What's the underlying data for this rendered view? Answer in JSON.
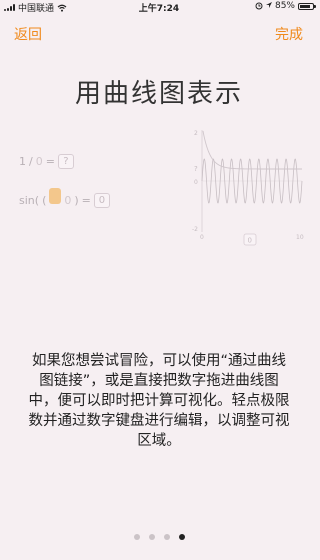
{
  "status_bar": {
    "carrier": "中国联通",
    "time": "上午7:24",
    "battery": "85%",
    "battery_level": 0.85
  },
  "nav": {
    "back_label": "返回",
    "done_label": "完成"
  },
  "page_title": "用曲线图表示",
  "demo": {
    "expr1": {
      "numerator": "1",
      "slash": "/",
      "denominator": "0",
      "equals": "=",
      "result": "?"
    },
    "expr2": {
      "func": "sin(",
      "paren_open": "(",
      "arg": "0",
      "paren_close": ")",
      "equals": "=",
      "result": "0"
    },
    "graph": {
      "y_top": "2",
      "y_q": "?",
      "y_zero": "0",
      "y_bottom": "-2",
      "x_min": "0",
      "x_max": "10",
      "x_box": "0"
    }
  },
  "body_text": "如果您想尝试冒险，可以使用“通过曲线图链接”，或是直接把数字拖进曲线图中，便可以即时把计算可视化。轻点极限数并通过数字键盘进行编辑，以调整可视区域。",
  "pager": {
    "count": 4,
    "active": 3
  },
  "colors": {
    "accent": "#f08a1c",
    "background": "#f6eff2"
  },
  "icons": [
    "wifi-icon",
    "alarm-icon",
    "battery-icon",
    "signal-icon"
  ]
}
